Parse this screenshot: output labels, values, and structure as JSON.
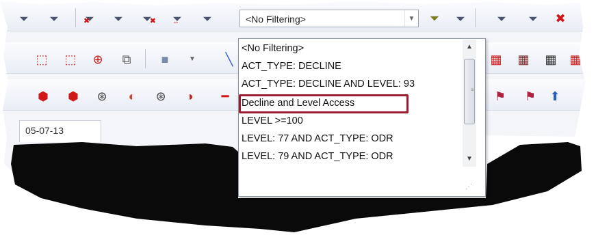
{
  "filter_combo": {
    "selected": "<No Filtering>"
  },
  "dropdown": {
    "options": [
      "<No Filtering>",
      "ACT_TYPE: DECLINE",
      "ACT_TYPE: DECLINE AND LEVEL: 93",
      "Decline and Level Access",
      "LEVEL >=100",
      "LEVEL: 77 AND ACT_TYPE: ODR",
      "LEVEL: 79 AND ACT_TYPE: ODR"
    ],
    "highlighted_index": 3
  },
  "tab": {
    "label": "05-07-13"
  },
  "colors": {
    "highlight_border": "#9b1b30",
    "icon_red": "#d01818",
    "icon_blue": "#2a5cc8"
  }
}
